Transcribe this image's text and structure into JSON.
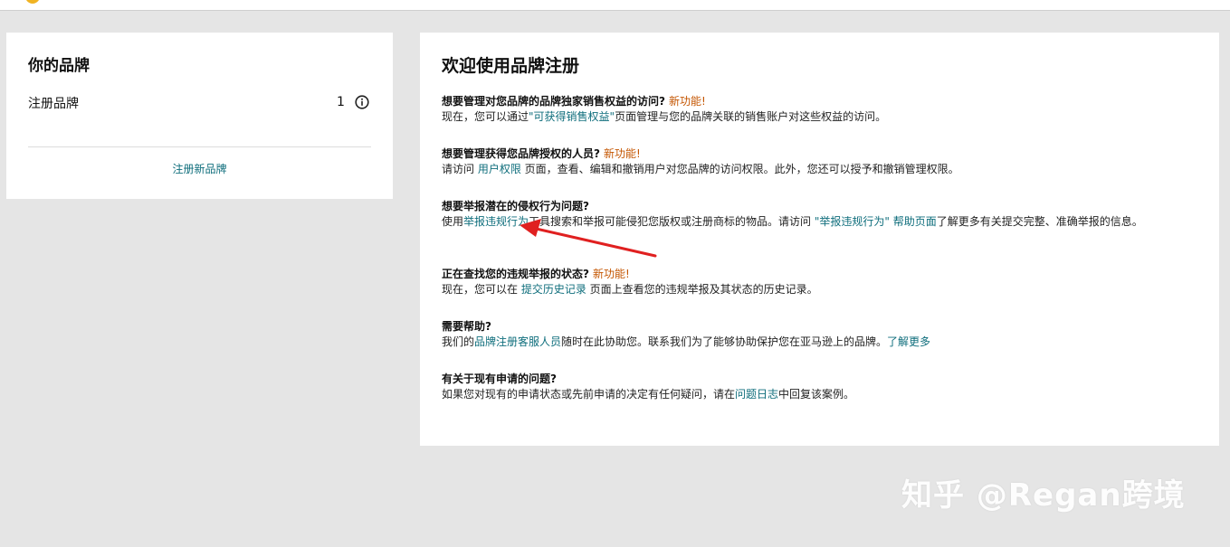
{
  "left_card": {
    "title": "你的品牌",
    "row_label": "注册品牌",
    "row_count": "1",
    "register_link": "注册新品牌"
  },
  "right_card": {
    "title": "欢迎使用品牌注册",
    "sections": [
      {
        "question": "想要管理对您品牌的品牌独家销售权益的访问?",
        "new": "新功能!",
        "line1_pre": "现在，您可以通过",
        "line1_link": "\"可获得销售权益\"",
        "line1_post": "页面管理与您的品牌关联的销售账户对这些权益的访问。"
      },
      {
        "question": "想要管理获得您品牌授权的人员?",
        "new": "新功能!",
        "line1_pre": "请访问 ",
        "line1_link": "用户权限",
        "line1_post": " 页面，查看、编辑和撤销用户对您品牌的访问权限。此外，您还可以授予和撤销管理权限。"
      },
      {
        "question": "想要举报潜在的侵权行为问题?",
        "line1_pre": "使用",
        "line1_link": "举报违规行为",
        "line1_mid": "工具搜索和举报可能侵犯您版权或注册商标的物品。请访问 ",
        "line1_link2": "\"举报违规行为\" 帮助页面",
        "line1_post": "了解更多有关提交完整、准确举报的信息。"
      },
      {
        "question": "正在查找您的违规举报的状态?",
        "new": "新功能!",
        "line1_pre": "现在，您可以在 ",
        "line1_link": "提交历史记录",
        "line1_post": " 页面上查看您的违规举报及其状态的历史记录。"
      },
      {
        "question": "需要帮助?",
        "line1_pre": "我们的",
        "line1_link": "品牌注册客服人员",
        "line1_mid": "随时在此协助您。联系我们为了能够协助保护您在亚马逊上的品牌。",
        "line1_link2": "了解更多"
      },
      {
        "question": "有关于现有申请的问题?",
        "line1_pre": "如果您对现有的申请状态或先前申请的决定有任何疑问，请在",
        "line1_link": "问题日志",
        "line1_post": "中回复该案例。"
      }
    ]
  },
  "icons": {
    "info": "info-circle-icon",
    "arrow": "red-annotation-arrow"
  },
  "colors": {
    "link": "#0f6e7c",
    "new_badge": "#c45500",
    "arrow": "#e02020",
    "background": "#e5e5e5"
  },
  "watermark": "知乎 @Regan跨境"
}
